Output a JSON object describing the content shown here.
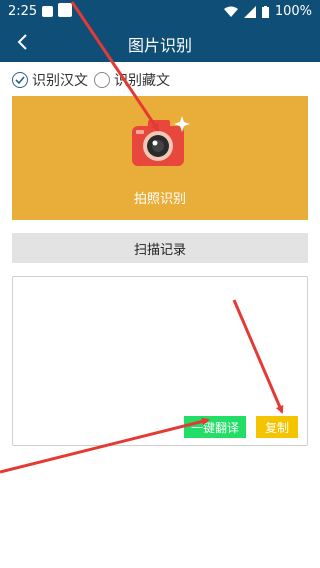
{
  "status_bar": {
    "time": "2:25",
    "battery": "100%"
  },
  "app_bar": {
    "title": "图片识别"
  },
  "options": [
    {
      "label": "识别汉文",
      "selected": true
    },
    {
      "label": "识别藏文",
      "selected": false
    }
  ],
  "camera_card": {
    "label": "拍照识别"
  },
  "scan_records_label": "扫描记录",
  "text_area": {
    "value": ""
  },
  "buttons": {
    "translate": "一键翻译",
    "copy": "复制"
  },
  "colors": {
    "header": "#0f4f77",
    "camera_card": "#e9ae3a",
    "translate_button": "#22dd66",
    "copy_button": "#f5c400",
    "annotation_arrow": "#e53935"
  }
}
